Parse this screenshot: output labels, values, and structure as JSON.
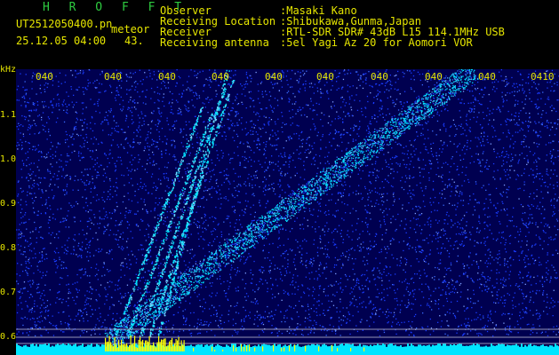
{
  "header": {
    "brand": "H R O F F T",
    "filename": "UT2512050400.pn",
    "tag": "meteor",
    "datetime": "25.12.05 04:00",
    "value": "43."
  },
  "info": [
    {
      "key": "Observer",
      "value": ":Masaki Kano"
    },
    {
      "key": "Receiving Location",
      "value": ":Shibukawa,Gunma,Japan"
    },
    {
      "key": "Receiver",
      "value": ":RTL-SDR SDR# 43dB L15 114.1MHz USB"
    },
    {
      "key": "Receiving antenna",
      "value": ":5el Yagi Az 20 for Aomori VOR"
    }
  ],
  "spectrogram": {
    "y_unit": "kHz",
    "y_ticks": [
      "1.1",
      "1.0",
      "0.9",
      "0.8",
      "0.7",
      "0.6"
    ],
    "x_ticks": [
      "040",
      "040",
      "040",
      "040",
      "040",
      "040",
      "040",
      "040",
      "040",
      "0410"
    ],
    "colors": {
      "background": "#000050",
      "noise": "#1a3cff",
      "signal": "#00e5ff",
      "peak": "#ffff00",
      "text": "#e6e600",
      "brand": "#2ecc40"
    }
  }
}
